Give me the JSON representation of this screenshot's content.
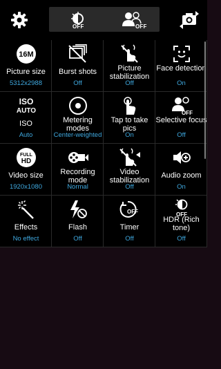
{
  "topbar": {
    "toggle_a_state": "OFF",
    "toggle_b_state": "OFF",
    "icons": [
      "gear-icon",
      "hdr-toggle-icon",
      "selective-focus-icon",
      "switch-camera-icon"
    ]
  },
  "settings": [
    {
      "label": "Picture size",
      "value": "5312x2988",
      "icon": "picture-size-icon",
      "icon_text": "16M"
    },
    {
      "label": "Burst shots",
      "value": "Off",
      "icon": "burst-shots-icon"
    },
    {
      "label": "Picture stabilization",
      "value": "Off",
      "icon": "picture-stabilization-icon"
    },
    {
      "label": "Face detection",
      "value": "On",
      "icon": "face-detection-icon"
    },
    {
      "label": "ISO",
      "value": "Auto",
      "icon": "iso-icon",
      "icon_text_top": "ISO",
      "icon_text_bottom": "AUTO"
    },
    {
      "label": "Metering modes",
      "value": "Center-weighted",
      "icon": "metering-icon"
    },
    {
      "label": "Tap to take pics",
      "value": "On",
      "icon": "tap-to-take-icon"
    },
    {
      "label": "Selective focus",
      "value": "Off",
      "icon": "selective-focus-icon",
      "icon_text": "OFF"
    },
    {
      "label": "Video size",
      "value": "1920x1080",
      "icon": "video-size-icon",
      "icon_text_top": "FULL",
      "icon_text_bottom": "HD"
    },
    {
      "label": "Recording mode",
      "value": "Normal",
      "icon": "recording-mode-icon"
    },
    {
      "label": "Video stabilization",
      "value": "Off",
      "icon": "video-stabilization-icon"
    },
    {
      "label": "Audio zoom",
      "value": "On",
      "icon": "audio-zoom-icon"
    },
    {
      "label": "Effects",
      "value": "No effect",
      "icon": "effects-icon"
    },
    {
      "label": "Flash",
      "value": "Off",
      "icon": "flash-off-icon"
    },
    {
      "label": "Timer",
      "value": "Off",
      "icon": "timer-icon",
      "icon_text": "OFF"
    },
    {
      "label": "HDR (Rich tone)",
      "value": "Off",
      "icon": "hdr-icon",
      "icon_text": "OFF"
    }
  ],
  "colors": {
    "background": "#170b13",
    "panel": "#000000",
    "value_blue": "#3fa9e0",
    "divider": "#2a2a2a"
  }
}
